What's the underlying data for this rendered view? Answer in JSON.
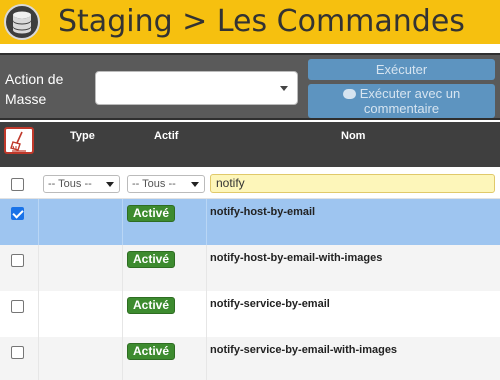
{
  "header": {
    "title": "Staging > Les Commandes"
  },
  "mass_action": {
    "label": "Action de Masse",
    "selected_value": "",
    "execute_label": "Exécuter",
    "execute_comment_label": "Exécuter avec un commentaire"
  },
  "table": {
    "columns": {
      "type": "Type",
      "actif": "Actif",
      "nom": "Nom"
    },
    "filters": {
      "type": "-- Tous --",
      "actif": "-- Tous --",
      "name": "notify"
    },
    "rows": [
      {
        "checked": true,
        "status": "Activé",
        "name": "notify-host-by-email"
      },
      {
        "checked": false,
        "status": "Activé",
        "name": "notify-host-by-email-with-images"
      },
      {
        "checked": false,
        "status": "Activé",
        "name": "notify-service-by-email"
      },
      {
        "checked": false,
        "status": "Activé",
        "name": "notify-service-by-email-with-images"
      }
    ]
  },
  "colors": {
    "header_bg": "#f6c00f",
    "toolbar_bg": "#5a5a5a",
    "table_header_bg": "#3f3f3f",
    "button_bg": "#5d94c0",
    "selected_row_bg": "#9ec5f0",
    "badge_bg": "#3d8b2f",
    "filter_highlight_bg": "#fdf6ba"
  },
  "icons": {
    "logo": "database-icon",
    "comment": "comment-icon",
    "clear_filters": "broom-icon",
    "dropdown": "chevron-down-icon"
  }
}
